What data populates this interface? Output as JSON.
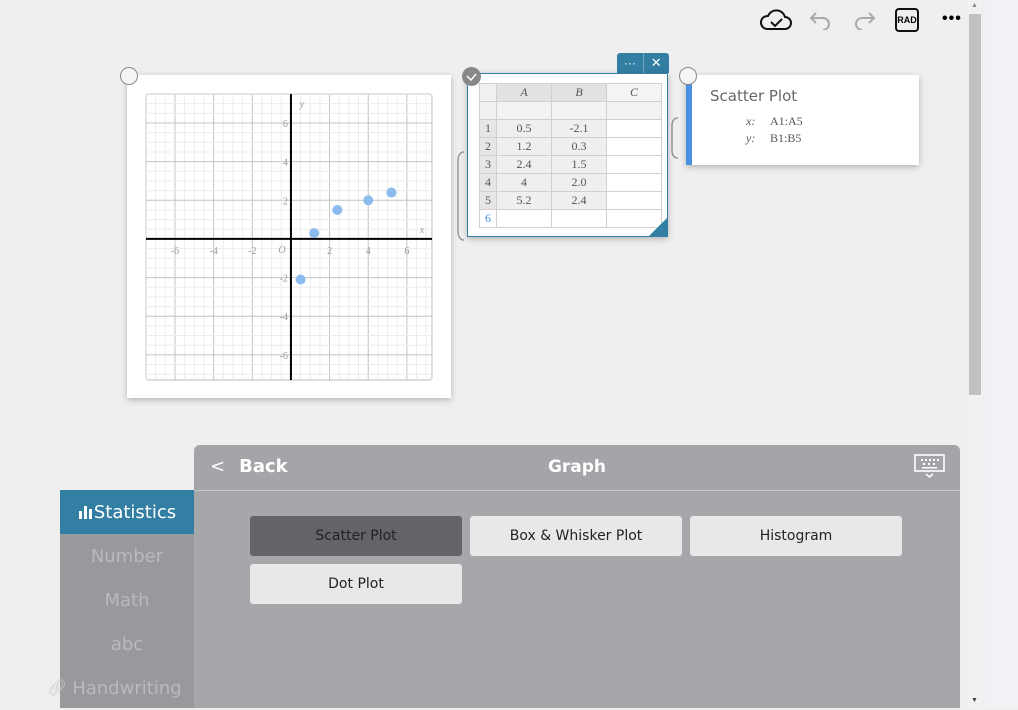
{
  "toolbar": {
    "icons": [
      "cloud-check-icon",
      "undo-icon",
      "redo-icon",
      "angle-mode-icon",
      "more-icon"
    ],
    "angle_mode": "RAD"
  },
  "graph": {
    "x_label": "x",
    "y_label": "y",
    "origin_label": "O",
    "x_ticks": [
      "-6",
      "-4",
      "-2",
      "2",
      "4",
      "6"
    ],
    "y_ticks": [
      "6",
      "4",
      "2",
      "-2",
      "-4",
      "-6"
    ],
    "point_color": "#8dbbed"
  },
  "chart_data": {
    "type": "scatter",
    "x": [
      0.5,
      1.2,
      2.4,
      4,
      5.2
    ],
    "y": [
      -2.1,
      0.3,
      1.5,
      2.0,
      2.4
    ],
    "xlim": [
      -7.5,
      7.3
    ],
    "ylim": [
      -7.3,
      7.5
    ],
    "grid": true,
    "xlabel": "x",
    "ylabel": "y"
  },
  "sheet": {
    "columns": [
      "A",
      "B",
      "C"
    ],
    "rows": [
      {
        "n": "1",
        "a": "0.5",
        "b": "-2.1",
        "c": ""
      },
      {
        "n": "2",
        "a": "1.2",
        "b": "0.3",
        "c": ""
      },
      {
        "n": "3",
        "a": "2.4",
        "b": "1.5",
        "c": ""
      },
      {
        "n": "4",
        "a": "4",
        "b": "2.0",
        "c": ""
      },
      {
        "n": "5",
        "a": "5.2",
        "b": "2.4",
        "c": ""
      },
      {
        "n": "6",
        "a": "",
        "b": "",
        "c": ""
      }
    ],
    "menu_label": "···",
    "close_label": "✕"
  },
  "scatter_def": {
    "title": "Scatter Plot",
    "x_label": "x:",
    "x_range": "A1:A5",
    "y_label": "y:",
    "y_range": "B1:B5",
    "accent": "#4a90e2"
  },
  "panel": {
    "back_label": "Back",
    "title": "Graph",
    "buttons": [
      "Scatter Plot",
      "Box & Whisker Plot",
      "Histogram",
      "Dot Plot"
    ],
    "selected": "Scatter Plot"
  },
  "sidebar": {
    "items": [
      {
        "label": "Statistics",
        "active": true
      },
      {
        "label": "Number"
      },
      {
        "label": "Math"
      },
      {
        "label": "abc"
      },
      {
        "label": "Handwriting"
      }
    ],
    "active_color": "#337fa3"
  }
}
